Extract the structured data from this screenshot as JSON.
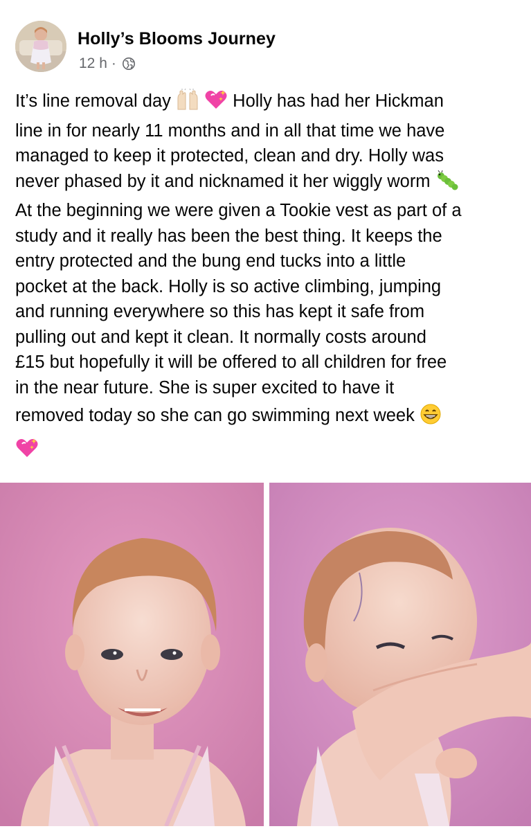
{
  "post": {
    "author": "Holly’s Blooms Journey",
    "time": "12 h",
    "separator": "·",
    "privacy_icon": "globe-icon",
    "lines": [
      "It’s line removal day",
      "Holly has had her Hickman",
      "line in for nearly 11 months and in all that time we have",
      "managed to keep it protected, clean and dry. Holly was",
      "never phased by it and nicknamed it her wiggly worm",
      "At the beginning we were given a Tookie vest as part of a",
      "study and it really has been the best thing. It keeps the",
      "entry protected and the bung end tucks into a little",
      "pocket at the back. Holly is so active climbing, jumping",
      "and running everywhere so this has kept it safe from",
      "pulling out and kept it clean. It normally costs around",
      "£15 but hopefully it will be offered to all children for free",
      "in the near future. She is super excited to have it",
      "removed today so she can go swimming next week"
    ],
    "emojis": {
      "raised_hands": "raising-hands-icon",
      "sparkling_heart": "sparkling-heart-icon",
      "caterpillar": "caterpillar-icon",
      "grin": "grinning-face-icon"
    }
  },
  "photos": [
    {
      "name": "photo-child-smiling",
      "background": "#d98fb7"
    },
    {
      "name": "photo-child-covering-face",
      "background": "#d48bc0"
    }
  ],
  "colors": {
    "text": "#050505",
    "meta": "#65676b",
    "photo_pink": "#d98fb7"
  }
}
